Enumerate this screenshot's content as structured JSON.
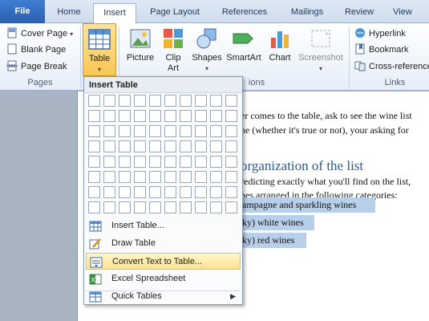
{
  "tabs": [
    "File",
    "Home",
    "Insert",
    "Page Layout",
    "References",
    "Mailings",
    "Review",
    "View"
  ],
  "ribbon": {
    "pages_group": {
      "items": [
        "Cover Page",
        "Blank Page",
        "Page Break"
      ],
      "label": "Pages"
    },
    "tables_group": {
      "table_label": "Table"
    },
    "illustrations_group": {
      "picture": "Picture",
      "clip_art": [
        "Clip",
        "Art"
      ],
      "shapes": "Shapes",
      "smartart": "SmartArt",
      "chart": "Chart",
      "screenshot": "Screenshot",
      "label_partial": "ions"
    },
    "links_group": {
      "items": [
        "Hyperlink",
        "Bookmark",
        "Cross-reference"
      ],
      "label": "Links"
    }
  },
  "dropdown": {
    "title": "Insert Table",
    "grid": {
      "columns": 10,
      "rows": 8
    },
    "items": [
      "Insert Table...",
      "Draw Table",
      "Convert Text to Table...",
      "Excel Spreadsheet",
      "Quick Tables"
    ]
  },
  "document": {
    "lines": [
      "er comes to the table, ask to see the wine list",
      "he (whether it's true or not), your asking for"
    ],
    "heading": "organization of the list",
    "body": [
      "redicting exactly what you'll find on the list,",
      "nes arranged in the following categories:"
    ],
    "selected_lines": [
      "ampagne  and  sparkling  wines",
      "ky)  white  wines",
      "ky)  red wines"
    ]
  },
  "colors": {
    "accent": "#2b5797",
    "highlight": "#b7cfe9",
    "hover": "#fde490"
  }
}
